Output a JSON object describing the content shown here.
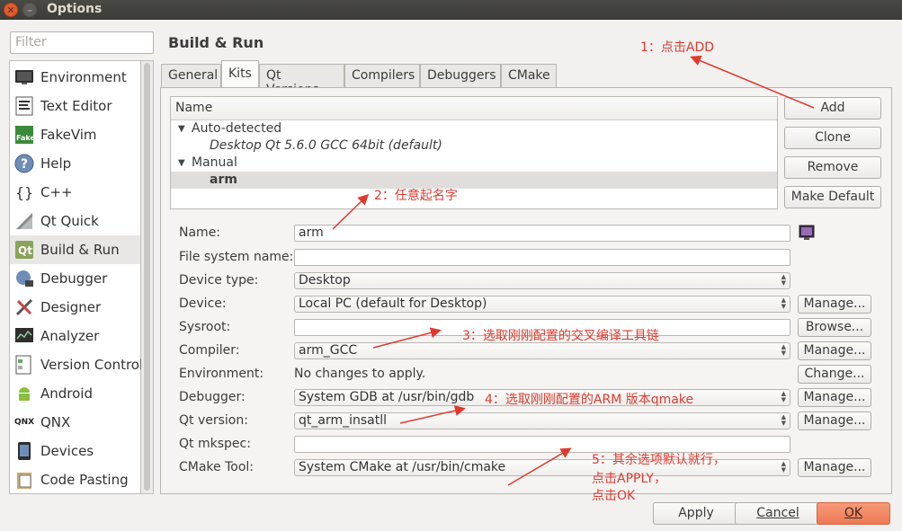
{
  "window": {
    "title": "Options"
  },
  "filter": {
    "placeholder": "Filter"
  },
  "sidebar": {
    "items": [
      {
        "label": "Environment",
        "icon": "monitor-icon"
      },
      {
        "label": "Text Editor",
        "icon": "text-editor-icon"
      },
      {
        "label": "FakeVim",
        "icon": "fakevim-icon"
      },
      {
        "label": "Help",
        "icon": "help-icon"
      },
      {
        "label": "C++",
        "icon": "braces-icon"
      },
      {
        "label": "Qt Quick",
        "icon": "qt-quick-icon"
      },
      {
        "label": "Build & Run",
        "icon": "build-run-icon"
      },
      {
        "label": "Debugger",
        "icon": "debugger-icon"
      },
      {
        "label": "Designer",
        "icon": "designer-icon"
      },
      {
        "label": "Analyzer",
        "icon": "analyzer-icon"
      },
      {
        "label": "Version Control",
        "icon": "version-control-icon"
      },
      {
        "label": "Android",
        "icon": "android-icon"
      },
      {
        "label": "QNX",
        "icon": "qnx-icon"
      },
      {
        "label": "Devices",
        "icon": "devices-icon"
      },
      {
        "label": "Code Pasting",
        "icon": "code-pasting-icon"
      }
    ],
    "selected": "Build & Run"
  },
  "page": {
    "title": "Build & Run"
  },
  "tabs": [
    "General",
    "Kits",
    "Qt Versions",
    "Compilers",
    "Debuggers",
    "CMake"
  ],
  "active_tab": "Kits",
  "tree": {
    "header": "Name",
    "rows": [
      {
        "text": "Auto-detected"
      },
      {
        "text": "Desktop Qt 5.6.0 GCC 64bit (default)"
      },
      {
        "text": "Manual"
      },
      {
        "text": "arm"
      }
    ]
  },
  "kit_buttons": {
    "add": "Add",
    "clone": "Clone",
    "remove": "Remove",
    "make_default": "Make Default"
  },
  "form": {
    "name_label": "Name:",
    "name_value": "arm",
    "fsname_label": "File system name:",
    "fsname_value": "",
    "device_type_label": "Device type:",
    "device_type_value": "Desktop",
    "device_label": "Device:",
    "device_value": "Local PC (default for Desktop)",
    "sysroot_label": "Sysroot:",
    "sysroot_value": "",
    "compiler_label": "Compiler:",
    "compiler_value": "arm_GCC",
    "environment_label": "Environment:",
    "environment_value": "No changes to apply.",
    "debugger_label": "Debugger:",
    "debugger_value": "System GDB at /usr/bin/gdb",
    "qt_version_label": "Qt version:",
    "qt_version_value": "qt_arm_insatll",
    "mkspec_label": "Qt mkspec:",
    "mkspec_value": "",
    "cmake_label": "CMake Tool:",
    "cmake_value": "System CMake at /usr/bin/cmake"
  },
  "side_buttons": {
    "manage": "Manage...",
    "browse": "Browse...",
    "change": "Change..."
  },
  "dialog_buttons": {
    "apply": "Apply",
    "cancel": "Cancel",
    "ok": "OK"
  },
  "annotations": {
    "a1": "1：点击ADD",
    "a2": "2：任意起名字",
    "a3": "3：选取刚刚配置的交叉编译工具链",
    "a4": "4：选取刚刚配置的ARM 版本qmake",
    "a5_line1": "5：其余选项默认就行，",
    "a5_line2": "点击APPLY，",
    "a5_line3": "点击OK"
  },
  "colors": {
    "annotation": "#e03a2e",
    "ok_button": "#ee7a56",
    "titlebar": "#3c3b37"
  }
}
